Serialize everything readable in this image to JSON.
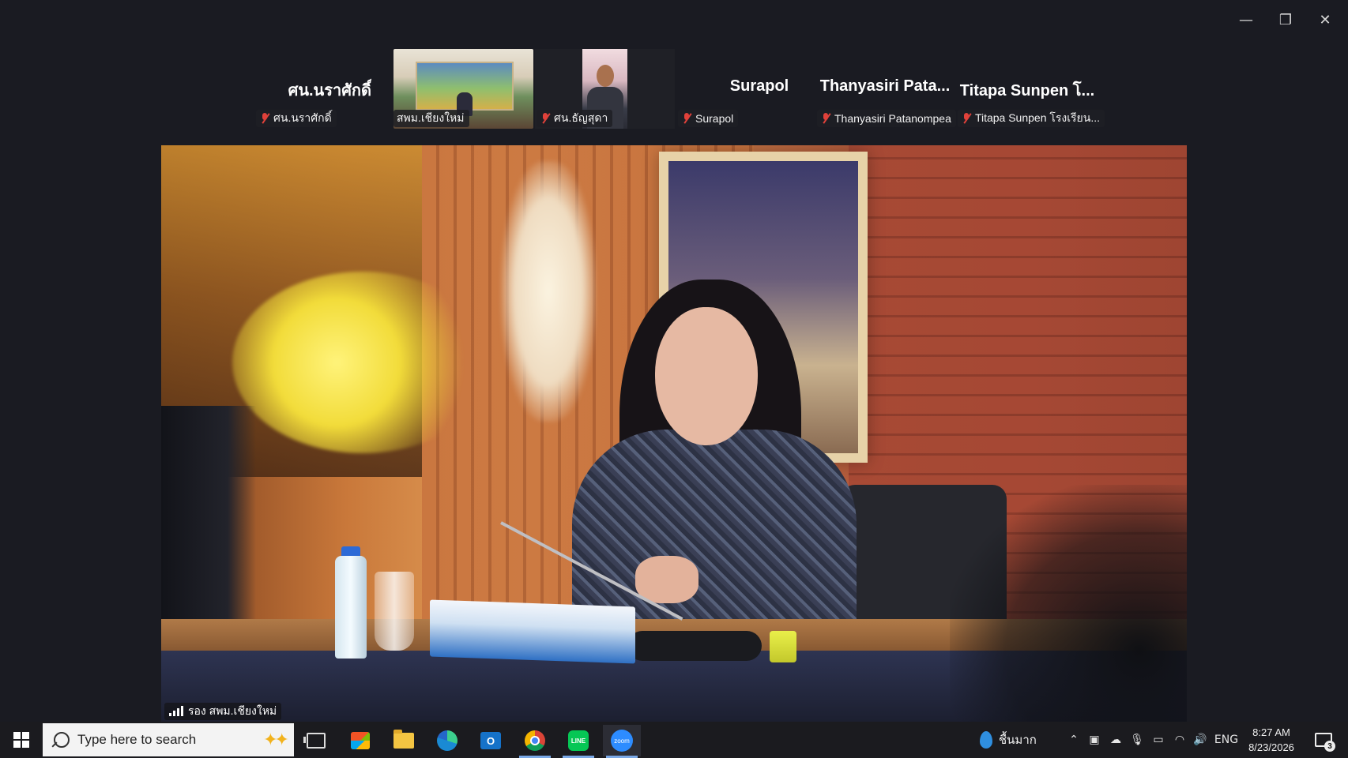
{
  "window": {
    "minimize_icon": "minimize-icon",
    "restore_icon": "restore-icon",
    "close_icon": "close-icon",
    "minimize_glyph": "—",
    "restore_glyph": "❐",
    "close_glyph": "✕"
  },
  "participants": [
    {
      "display_name": "ศน.นราศักดิ์",
      "tag": "ศน.นราศักดิ์",
      "muted": true,
      "video": false
    },
    {
      "display_name": "",
      "tag": "สพม.เชียงใหม่",
      "muted": false,
      "video": true
    },
    {
      "display_name": "",
      "tag": "ศน.ธัญสุดา",
      "muted": true,
      "video": true
    },
    {
      "display_name": "Surapol",
      "tag": "Surapol",
      "muted": true,
      "video": false
    },
    {
      "display_name": "Thanyasiri  Pata...",
      "tag": "Thanyasiri Patanompea",
      "muted": true,
      "video": false
    },
    {
      "display_name": "Titapa  Sunpen โ...",
      "tag": "Titapa Sunpen โรงเรียน...",
      "muted": true,
      "video": false
    }
  ],
  "main_video": {
    "speaker_label": "รอง สพม.เชียงใหม่"
  },
  "taskbar": {
    "search_placeholder": "Type here to search",
    "apps": [
      "task-view",
      "microsoft-store",
      "file-explorer",
      "edge",
      "outlook",
      "chrome",
      "line",
      "zoom"
    ],
    "line_label": "LINE",
    "zoom_label": "zoom",
    "outlook_label": "O",
    "weather_text": "ชื้นมาก",
    "language": "ENG",
    "time": "8:27 AM",
    "date": "8/23/2026",
    "notification_count": "3",
    "colors": {
      "zoom": "#2d8cff",
      "line": "#06c755",
      "muted": "#e0413a"
    }
  }
}
